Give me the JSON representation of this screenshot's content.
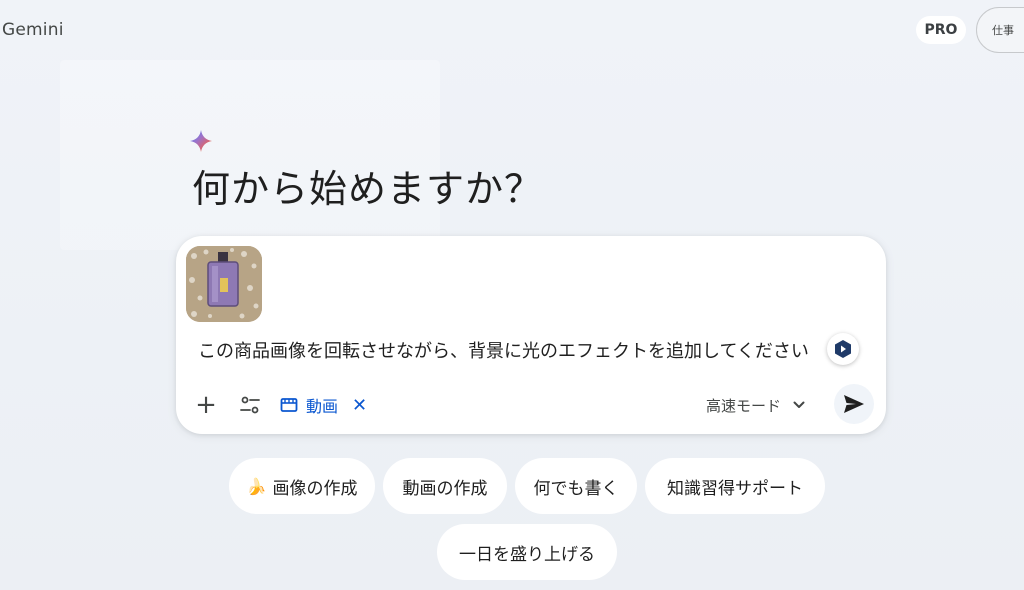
{
  "header": {
    "app_title": "Gemini",
    "pro_badge": "PRO",
    "work_label": "仕事"
  },
  "main": {
    "greeting": "何から始めますか？"
  },
  "composer": {
    "attachment_icon": "perfume-bottle-thumbnail",
    "prompt_text": "この商品画像を回転させながら、背景に光のエフェクトを追加してください",
    "tool_chip_label": "動画",
    "mode_label": "高速モード",
    "icons": {
      "add": "plus-icon",
      "tools": "tools-icon",
      "video": "video-icon",
      "remove": "close-icon",
      "mode": "chevron-down-icon",
      "send": "send-icon",
      "extension": "extension-icon"
    },
    "accent_color": "#0b57d0"
  },
  "suggestions": {
    "items": [
      {
        "label": "画像の作成",
        "icon": "banana-icon"
      },
      {
        "label": "動画の作成"
      },
      {
        "label": "何でも書く"
      },
      {
        "label": "知識習得サポート"
      },
      {
        "label": "一日を盛り上げる"
      }
    ]
  }
}
